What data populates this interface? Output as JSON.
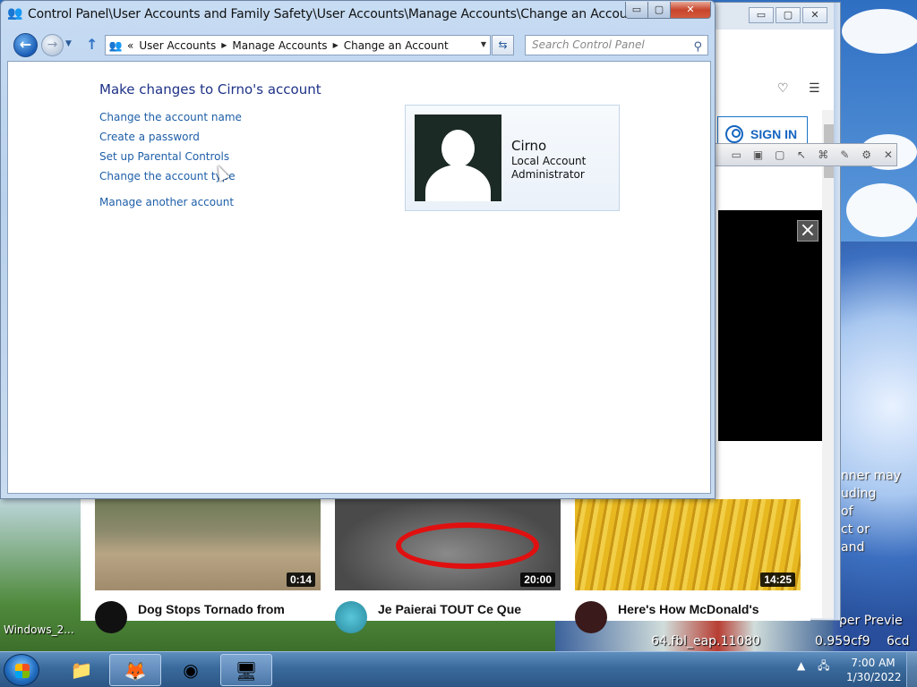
{
  "control_panel": {
    "title": "Control Panel\\User Accounts and Family Safety\\User Accounts\\Manage Accounts\\Change an Account",
    "window_controls": {
      "minimize": "▭",
      "maximize": "▢",
      "close": "✕"
    },
    "breadcrumb": {
      "prefix": "«",
      "items": [
        "User Accounts",
        "Manage Accounts",
        "Change an Account"
      ]
    },
    "search_placeholder": "Search Control Panel",
    "heading": "Make changes to Cirno's account",
    "links": [
      "Change the account name",
      "Create a password",
      "Set up Parental Controls",
      "Change the account type",
      "Manage another account"
    ],
    "account": {
      "name": "Cirno",
      "type": "Local Account",
      "role": "Administrator"
    }
  },
  "browser": {
    "sign_in": "SIGN IN",
    "side_text": [
      "nner may",
      "uding",
      "of",
      "ct or",
      "and"
    ]
  },
  "videos": [
    {
      "duration": "0:14",
      "title": "Dog Stops Tornado from"
    },
    {
      "duration": "20:00",
      "title": "Je Paierai TOUT Ce Que"
    },
    {
      "duration": "14:25",
      "title": "Here's How McDonald's"
    }
  ],
  "desktop": {
    "tooltip": "Windows_2...",
    "build_text": "64.fbl_eap.11080",
    "build_text2": "0.959cf9",
    "build_text3": "6cd",
    "preview_text": "per Previe"
  },
  "taskbar": {
    "clock_time": "7:00 AM",
    "clock_date": "1/30/2022"
  },
  "colors": {
    "link": "#1e5fa8",
    "heading": "#1e3287",
    "accent": "#1565c0"
  }
}
